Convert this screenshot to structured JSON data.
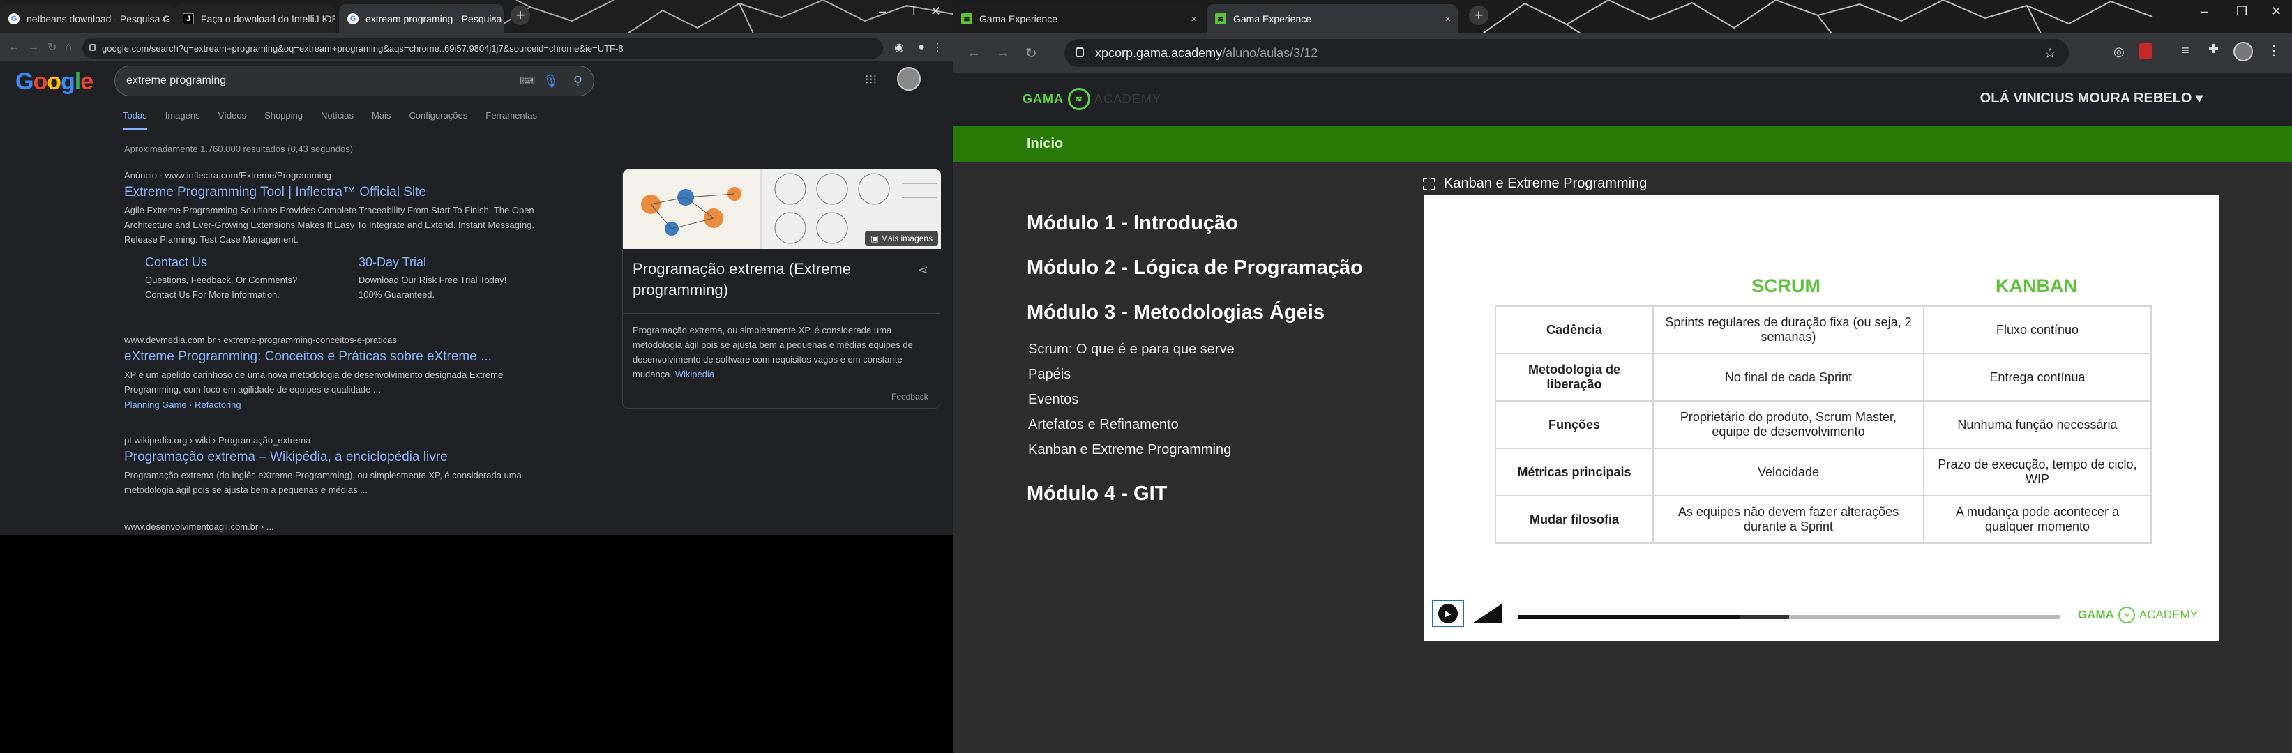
{
  "left_browser": {
    "tabs": [
      {
        "title": "netbeans download - Pesquisa G",
        "icon": "google-icon"
      },
      {
        "title": "Faça o download do IntelliJ IDEA",
        "icon": "jetbrains-icon"
      },
      {
        "title": "extream programing - Pesquisa G",
        "icon": "google-icon",
        "active": true
      }
    ],
    "url": "google.com/search?q=extream+programing&oq=extream+programing&aqs=chrome..69i57.9804j1j7&sourceid=chrome&ie=UTF-8"
  },
  "google": {
    "logo": "Google",
    "query": "extreme programing",
    "tabs": [
      "Todas",
      "Imagens",
      "Vídeos",
      "Shopping",
      "Notícias",
      "Mais",
      "Configurações",
      "Ferramentas"
    ],
    "result_count": "Aproximadamente 1.760.000 resultados (0,43 segundos)",
    "ad": {
      "cite": "Anúncio · www.inflectra.com/Extreme/Programming",
      "title": "Extreme Programming Tool | Inflectra™ Official Site",
      "snippet": "Agile Extreme Programming Solutions Provides Complete Traceability From Start To Finish. The Open Architecture and Ever-Growing Extensions Makes It Easy To Integrate and Extend. Instant Messaging. Release Planning. Test Case Management.",
      "sitelink1_title": "Contact Us",
      "sitelink1_desc": "Questions, Feedback, Or Comments? Contact Us For More Information.",
      "sitelink2_title": "30-Day Trial",
      "sitelink2_desc": "Download Our Risk Free Trial Today! 100% Guaranteed."
    },
    "result1": {
      "cite": "www.devmedia.com.br › extreme-programming-conceitos-e-praticas",
      "title": "eXtreme Programming: Conceitos e Práticas sobre eXtreme ...",
      "snippet": "XP é um apelido carinhoso de uma nova metodologia de desenvolvimento designada Extreme Programming, com foco em agilidade de equipes e qualidade ...",
      "sublinks": "Planning Game · Refactoring"
    },
    "result2": {
      "cite": "pt.wikipedia.org › wiki › Programação_extrema",
      "title": "Programação extrema – Wikipédia, a enciclopédia livre",
      "snippet": "Programação extrema (do inglês eXtreme Programming), ou simplesmente XP, é considerada uma metodologia ágil pois se ajusta bem a pequenas e médias ..."
    },
    "result3_cite": "www.desenvolvimentoagil.com.br › ...",
    "knowledge_panel": {
      "more_images": "Mais imagens",
      "title": "Programação extrema (Extreme programming)",
      "description": "Programação extrema, ou simplesmente XP, é considerada uma metodologia ágil pois se ajusta bem a pequenas e médias equipes de desenvolvimento de software com requisitos vagos e em constante mudança.",
      "source": "Wikipédia"
    },
    "feedback": "Feedback"
  },
  "right_browser": {
    "tabs": [
      {
        "title": "Gama Experience"
      },
      {
        "title": "Gama Experience",
        "active": true
      }
    ],
    "url_host": "xpcorp.gama.academy",
    "url_path": "/aluno/aulas/3/12"
  },
  "gama": {
    "logo_text": "GAMA",
    "logo_suffix": "ACADEMY",
    "user_greeting": "OLÁ VINICIUS MOURA REBELO",
    "nav_home": "Início",
    "modules": [
      "Módulo 1 - Introdução",
      "Módulo 2 - Lógica de Programação",
      "Módulo 3 - Metodologias Ágeis",
      "Módulo 4 - GIT"
    ],
    "lessons": [
      "Scrum: O que é e para que serve",
      "Papéis",
      "Eventos",
      "Artefatos e Refinamento",
      "Kanban e Extreme Programming"
    ],
    "video_title": "Kanban e Extreme Programming",
    "slide": {
      "col_scrum": "SCRUM",
      "col_kanban": "KANBAN",
      "rows": [
        {
          "label": "Cadência",
          "scrum": "Sprints regulares de duração fixa (ou seja, 2 semanas)",
          "kanban": "Fluxo contínuo"
        },
        {
          "label": "Metodologia de liberação",
          "scrum": "No final de cada Sprint",
          "kanban": "Entrega contínua"
        },
        {
          "label": "Funções",
          "scrum": "Proprietário do produto, Scrum Master, equipe de desenvolvimento",
          "kanban": "Nunhuma função necessária"
        },
        {
          "label": "Métricas principais",
          "scrum": "Velocidade",
          "kanban": "Prazo de execução, tempo de ciclo, WIP"
        },
        {
          "label": "Mudar filosofia",
          "scrum": "As equipes não devem fazer alterações durante a Sprint",
          "kanban": "A mudança pode acontecer a qualquer momento"
        }
      ]
    },
    "player": {
      "progress": 0.41,
      "buffered": 0.5,
      "logo_text": "GAMA",
      "logo_suffix": "ACADEMY"
    }
  },
  "colors": {
    "gama_green": "#5fc23a",
    "nav_green": "#2a7a0a",
    "google_link": "#8ab4f8",
    "dark_bg": "#202124"
  }
}
